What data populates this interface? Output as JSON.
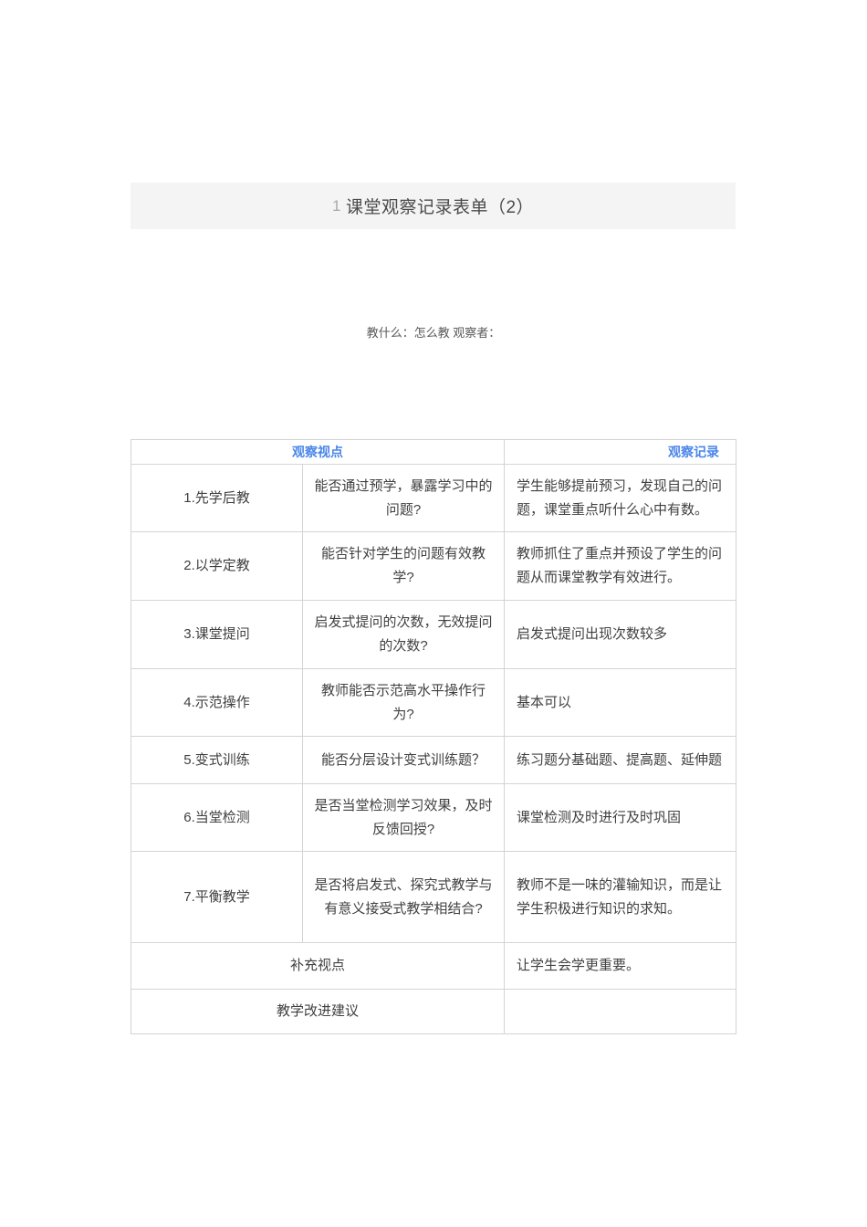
{
  "page": {
    "title_prefix": "1",
    "title": "课堂观察记录表单（2）",
    "meta_line": "教什么：怎么教 观察者："
  },
  "table": {
    "headers": {
      "viewpoint": "观察视点",
      "record": "观察记录"
    },
    "rows": [
      {
        "name": "1.先学后教",
        "question": "能否通过预学，暴露学习中的问题?",
        "record": "学生能够提前预习，发现自己的问题，课堂重点听什么心中有数。"
      },
      {
        "name": "2.以学定教",
        "question": "能否针对学生的问题有效教学?",
        "record": "教师抓住了重点并预设了学生的问题从而课堂教学有效进行。"
      },
      {
        "name": "3.课堂提问",
        "question": "启发式提问的次数，无效提问的次数?",
        "record": "启发式提问出现次数较多"
      },
      {
        "name": "4.示范操作",
        "question": "教师能否示范高水平操作行为?",
        "record": "基本可以"
      },
      {
        "name": "5.变式训练",
        "question": "能否分层设计变式训练题？",
        "record": "练习题分基础题、提高题、延伸题"
      },
      {
        "name": "6.当堂检测",
        "question": "是否当堂检测学习效果，及时反馈回授?",
        "record": "课堂检测及时进行及时巩固"
      },
      {
        "name": "7.平衡教学",
        "question": "是否将启发式、探究式教学与有意义接受式教学相结合?",
        "record": "教师不是一味的灌输知识，而是让学生积极进行知识的求知。"
      }
    ],
    "footer_rows": [
      {
        "label": "补充视点",
        "record": "让学生会学更重要。"
      },
      {
        "label": "教学改进建议",
        "record": ""
      }
    ]
  },
  "colors": {
    "accent_blue": "#4a86e8",
    "title_bar_bg": "#f4f4f4",
    "border": "#d4d4d4"
  }
}
